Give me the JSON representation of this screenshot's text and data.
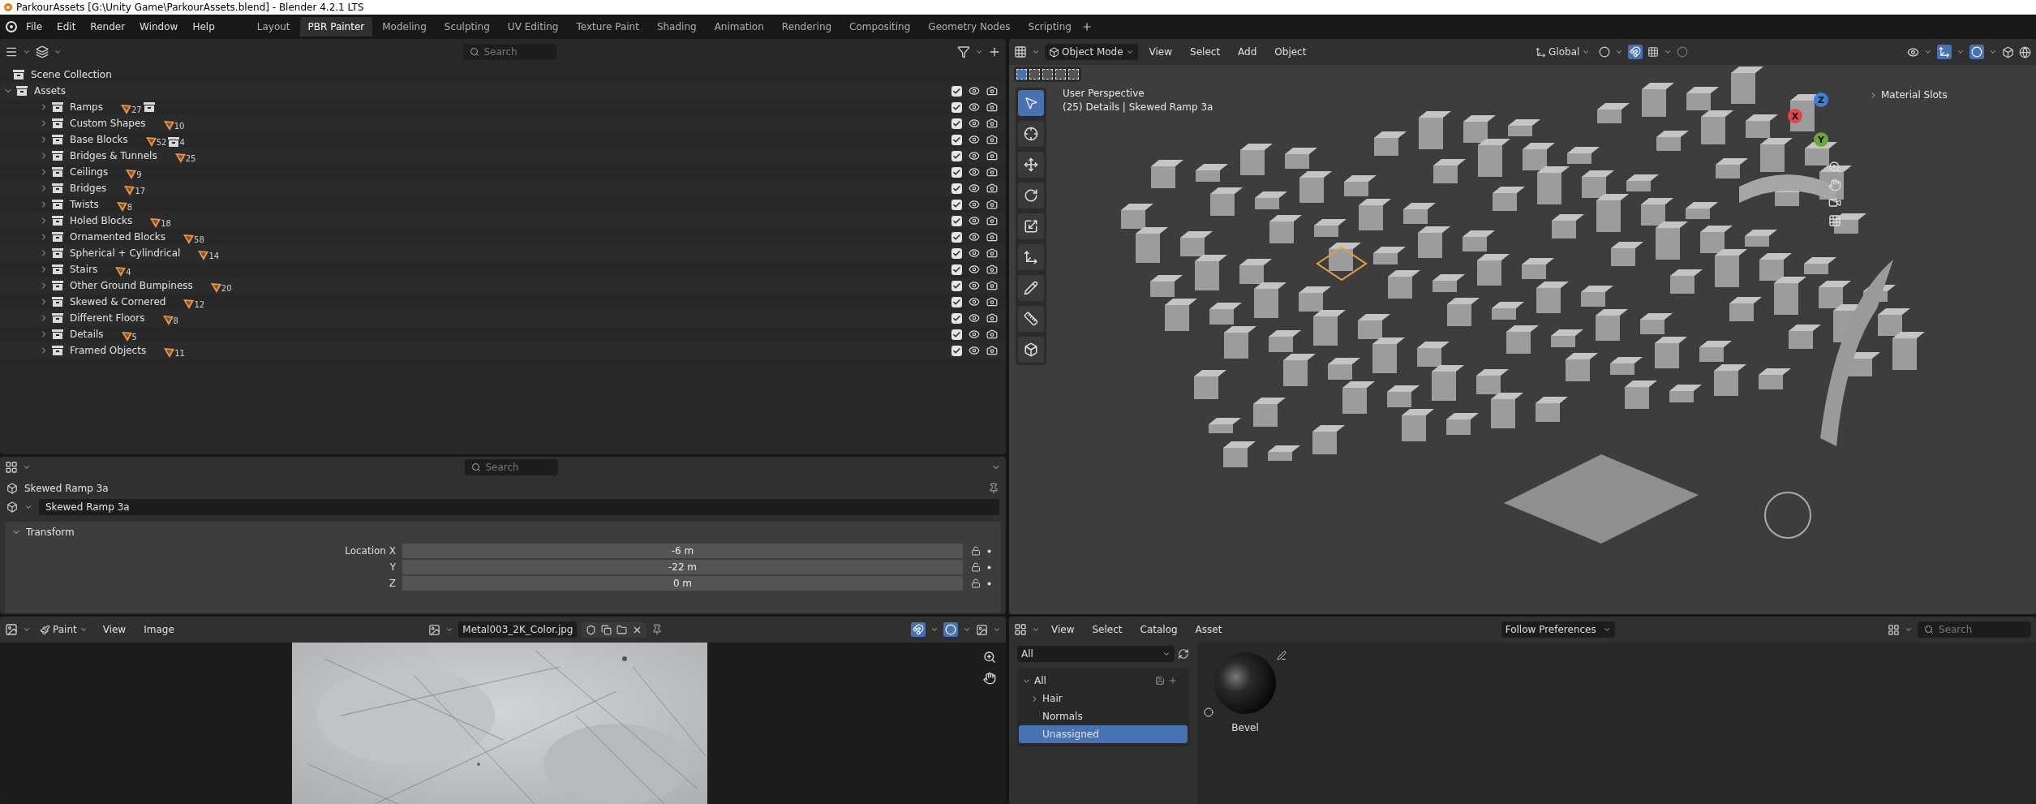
{
  "window": {
    "title": "ParkourAssets [G:\\Unity Game\\ParkourAssets.blend] - Blender 4.2.1 LTS"
  },
  "menu": [
    "File",
    "Edit",
    "Render",
    "Window",
    "Help"
  ],
  "workspaces": [
    {
      "label": "Layout",
      "selected": false
    },
    {
      "label": "PBR Painter",
      "selected": true
    },
    {
      "label": "Modeling",
      "selected": false
    },
    {
      "label": "Sculpting",
      "selected": false
    },
    {
      "label": "UV Editing",
      "selected": false
    },
    {
      "label": "Texture Paint",
      "selected": false
    },
    {
      "label": "Shading",
      "selected": false
    },
    {
      "label": "Animation",
      "selected": false
    },
    {
      "label": "Rendering",
      "selected": false
    },
    {
      "label": "Compositing",
      "selected": false
    },
    {
      "label": "Geometry Nodes",
      "selected": false
    },
    {
      "label": "Scripting",
      "selected": false
    }
  ],
  "outliner": {
    "search": {
      "placeholder": "Search"
    },
    "root": "Scene Collection",
    "tree": [
      {
        "name": "Assets",
        "expanded": true,
        "checked": true,
        "children": [
          {
            "name": "Ramps",
            "expanded": false,
            "objects": "27",
            "child_collection": true,
            "checked": true
          },
          {
            "name": "Custom Shapes",
            "expanded": false,
            "objects": "10",
            "checked": true
          },
          {
            "name": "Base Blocks",
            "expanded": false,
            "objects": "52",
            "child_collection": true,
            "collections": "4",
            "checked": true
          },
          {
            "name": "Bridges & Tunnels",
            "expanded": false,
            "objects": "25",
            "checked": true
          },
          {
            "name": "Ceilings",
            "expanded": false,
            "objects": "9",
            "checked": true
          },
          {
            "name": "Bridges",
            "expanded": false,
            "objects": "17",
            "checked": true
          },
          {
            "name": "Twists",
            "expanded": false,
            "objects": "8",
            "checked": true
          },
          {
            "name": "Holed Blocks",
            "expanded": false,
            "objects": "18",
            "checked": true
          },
          {
            "name": "Ornamented Blocks",
            "expanded": false,
            "objects": "58",
            "checked": true
          },
          {
            "name": "Spherical + Cylindrical",
            "expanded": false,
            "objects": "14",
            "checked": true
          },
          {
            "name": "Stairs",
            "expanded": false,
            "objects": "4",
            "checked": true
          },
          {
            "name": "Other Ground Bumpiness",
            "expanded": false,
            "objects": "20",
            "checked": true
          },
          {
            "name": "Skewed & Cornered",
            "expanded": false,
            "objects": "12",
            "checked": true
          },
          {
            "name": "Different Floors",
            "expanded": false,
            "objects": "8",
            "checked": true
          },
          {
            "name": "Details",
            "expanded": false,
            "objects": "5",
            "checked": true
          },
          {
            "name": "Framed Objects",
            "expanded": false,
            "objects": "11",
            "checked": true
          }
        ]
      }
    ]
  },
  "properties": {
    "search": {
      "placeholder": "Search"
    },
    "object": "Skewed Ramp 3a",
    "name_field": "Skewed Ramp 3a",
    "panel": {
      "title": "Transform",
      "expanded": true,
      "fields": [
        {
          "label": "Location X",
          "value": "-6 m"
        },
        {
          "label": "Y",
          "value": "-22 m"
        },
        {
          "label": "Z",
          "value": "0 m"
        }
      ]
    }
  },
  "image_editor": {
    "mode": "Paint",
    "menus": [
      "View",
      "Image"
    ],
    "image": "Metal003_2K_Color.jpg"
  },
  "viewport": {
    "mode": "Object Mode",
    "menus": [
      "View",
      "Select",
      "Add",
      "Object"
    ],
    "orientation": "Global",
    "overlay": [
      "User Perspective",
      "(25) Details | Skewed Ramp 3a"
    ],
    "side_panel": "Material Slots",
    "axes": [
      "X",
      "Y",
      "Z"
    ]
  },
  "asset_browser": {
    "menus": [
      "View",
      "Select",
      "Catalog",
      "Asset"
    ],
    "import_method": "Follow Preferences",
    "search": {
      "placeholder": "Search"
    },
    "library": "All",
    "catalogs": [
      {
        "name": "All",
        "expanded": true,
        "selected": false,
        "children": [
          {
            "name": "Hair",
            "expanded": false,
            "selected": false
          },
          {
            "name": "Normals",
            "selected": false
          },
          {
            "name": "Unassigned",
            "selected": true
          }
        ]
      }
    ],
    "assets": [
      {
        "name": "Bevel"
      }
    ]
  }
}
